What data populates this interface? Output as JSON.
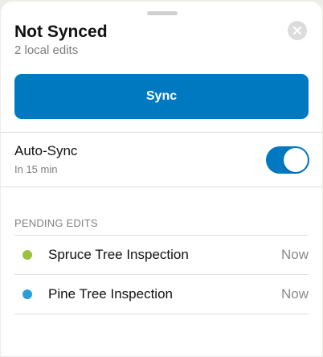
{
  "header": {
    "title": "Not Synced",
    "subtitle": "2 local edits"
  },
  "actions": {
    "sync_label": "Sync"
  },
  "auto_sync": {
    "label": "Auto-Sync",
    "detail": "In 15 min",
    "enabled": true
  },
  "pending": {
    "section_title": "PENDING EDITS",
    "items": [
      {
        "label": "Spruce Tree Inspection",
        "time": "Now",
        "color": "#9ac13d"
      },
      {
        "label": "Pine Tree Inspection",
        "time": "Now",
        "color": "#2a9fd6"
      }
    ]
  },
  "colors": {
    "accent": "#0079c1",
    "close_button": "#dcdcdc"
  },
  "icons": {
    "close": "close-icon"
  }
}
